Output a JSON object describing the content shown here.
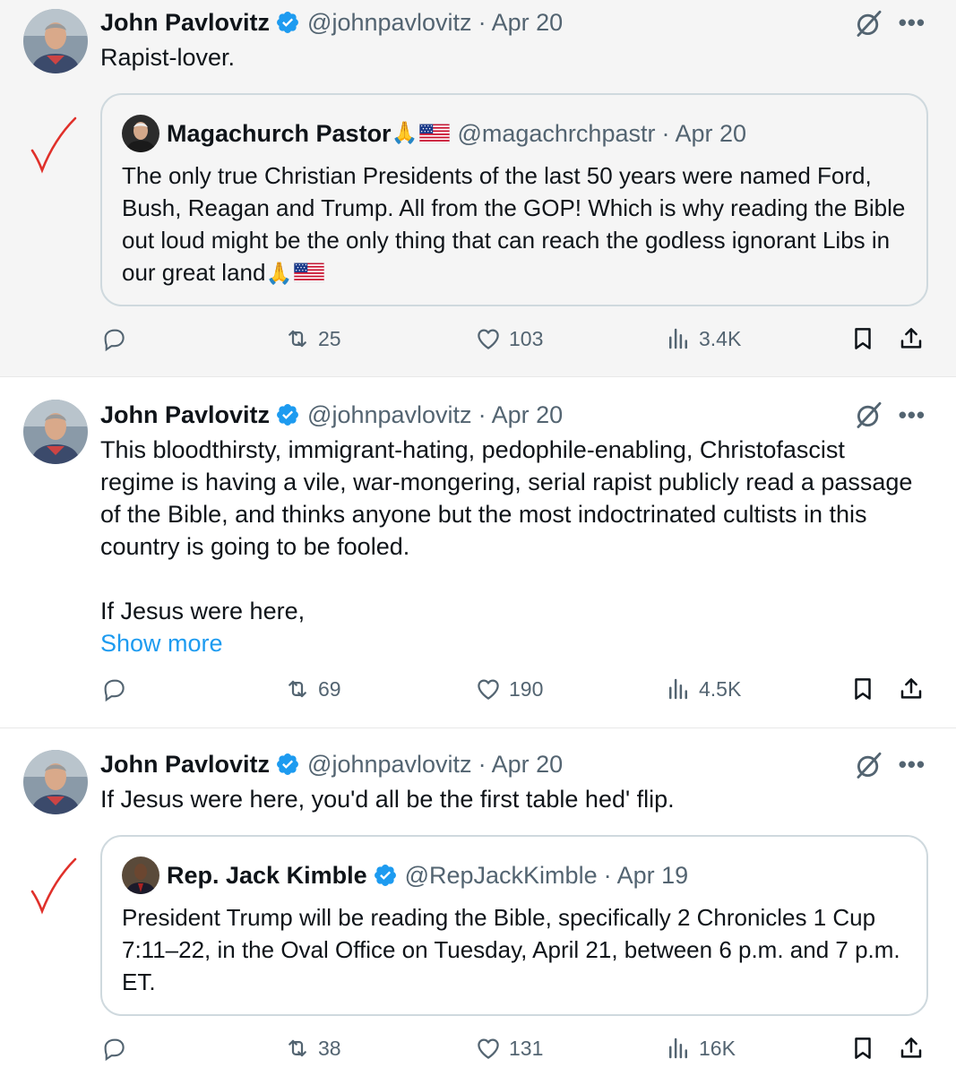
{
  "tweets": [
    {
      "author": "John Pavlovitz",
      "handle": "@johnpavlovitz",
      "date": "· Apr 20",
      "text": "Rapist-lover.",
      "quote": {
        "author": "Magachurch Pastor",
        "author_emoji": "🙏",
        "handle": "@magachrchpastr",
        "date": "· Apr 20",
        "text": "The only true Christian Presidents of the last 50 years were named Ford, Bush, Reagan and Trump. All from the GOP! Which is why reading the Bible out loud might be the only thing that can reach the godless ignorant Libs in our great land",
        "text_emoji": "🙏"
      },
      "stats": {
        "reposts": "25",
        "likes": "103",
        "views": "3.4K"
      }
    },
    {
      "author": "John Pavlovitz",
      "handle": "@johnpavlovitz",
      "date": "· Apr 20",
      "text_lines": [
        "This bloodthirsty, immigrant-hating, pedophile-enabling, Christofascist",
        "regime is having a vile, war-mongering, serial rapist publicly read a passage",
        "of the Bible, and thinks anyone but the most indoctrinated cultists in this",
        "country is going to be fooled."
      ],
      "text_2": "If Jesus were here,",
      "show_more": "Show more",
      "stats": {
        "reposts": "69",
        "likes": "190",
        "views": "4.5K"
      }
    },
    {
      "author": "John Pavlovitz",
      "handle": "@johnpavlovitz",
      "date": "· Apr 20",
      "text": "If Jesus were here, you'd all be the first table hed' flip.",
      "quote": {
        "author": "Rep. Jack Kimble",
        "handle": "@RepJackKimble",
        "date": "· Apr 19",
        "text": "President Trump will be reading the Bible, specifically 2 Chronicles 1 Cup 7:11–22, in the Oval Office on Tuesday, April 21, between 6 p.m. and 7 p.m. ET."
      },
      "stats": {
        "reposts": "38",
        "likes": "131",
        "views": "16K"
      }
    }
  ],
  "colors": {
    "accent": "#1d9bf0",
    "muted": "#536471",
    "check_mark": "#e0302a"
  }
}
